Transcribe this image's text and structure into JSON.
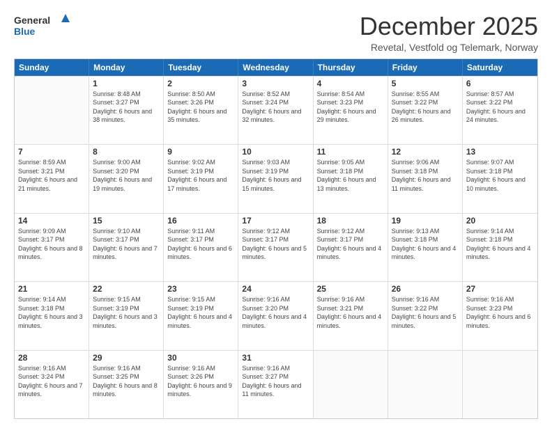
{
  "logo": {
    "line1": "General",
    "line2": "Blue"
  },
  "title": "December 2025",
  "location": "Revetal, Vestfold og Telemark, Norway",
  "days": [
    "Sunday",
    "Monday",
    "Tuesday",
    "Wednesday",
    "Thursday",
    "Friday",
    "Saturday"
  ],
  "weeks": [
    [
      {
        "day": "",
        "empty": true
      },
      {
        "day": "1",
        "sunrise": "8:48 AM",
        "sunset": "3:27 PM",
        "daylight": "6 hours and 38 minutes."
      },
      {
        "day": "2",
        "sunrise": "8:50 AM",
        "sunset": "3:26 PM",
        "daylight": "6 hours and 35 minutes."
      },
      {
        "day": "3",
        "sunrise": "8:52 AM",
        "sunset": "3:24 PM",
        "daylight": "6 hours and 32 minutes."
      },
      {
        "day": "4",
        "sunrise": "8:54 AM",
        "sunset": "3:23 PM",
        "daylight": "6 hours and 29 minutes."
      },
      {
        "day": "5",
        "sunrise": "8:55 AM",
        "sunset": "3:22 PM",
        "daylight": "6 hours and 26 minutes."
      },
      {
        "day": "6",
        "sunrise": "8:57 AM",
        "sunset": "3:22 PM",
        "daylight": "6 hours and 24 minutes."
      }
    ],
    [
      {
        "day": "7",
        "sunrise": "8:59 AM",
        "sunset": "3:21 PM",
        "daylight": "6 hours and 21 minutes."
      },
      {
        "day": "8",
        "sunrise": "9:00 AM",
        "sunset": "3:20 PM",
        "daylight": "6 hours and 19 minutes."
      },
      {
        "day": "9",
        "sunrise": "9:02 AM",
        "sunset": "3:19 PM",
        "daylight": "6 hours and 17 minutes."
      },
      {
        "day": "10",
        "sunrise": "9:03 AM",
        "sunset": "3:19 PM",
        "daylight": "6 hours and 15 minutes."
      },
      {
        "day": "11",
        "sunrise": "9:05 AM",
        "sunset": "3:18 PM",
        "daylight": "6 hours and 13 minutes."
      },
      {
        "day": "12",
        "sunrise": "9:06 AM",
        "sunset": "3:18 PM",
        "daylight": "6 hours and 11 minutes."
      },
      {
        "day": "13",
        "sunrise": "9:07 AM",
        "sunset": "3:18 PM",
        "daylight": "6 hours and 10 minutes."
      }
    ],
    [
      {
        "day": "14",
        "sunrise": "9:09 AM",
        "sunset": "3:17 PM",
        "daylight": "6 hours and 8 minutes."
      },
      {
        "day": "15",
        "sunrise": "9:10 AM",
        "sunset": "3:17 PM",
        "daylight": "6 hours and 7 minutes."
      },
      {
        "day": "16",
        "sunrise": "9:11 AM",
        "sunset": "3:17 PM",
        "daylight": "6 hours and 6 minutes."
      },
      {
        "day": "17",
        "sunrise": "9:12 AM",
        "sunset": "3:17 PM",
        "daylight": "6 hours and 5 minutes."
      },
      {
        "day": "18",
        "sunrise": "9:12 AM",
        "sunset": "3:17 PM",
        "daylight": "6 hours and 4 minutes."
      },
      {
        "day": "19",
        "sunrise": "9:13 AM",
        "sunset": "3:18 PM",
        "daylight": "6 hours and 4 minutes."
      },
      {
        "day": "20",
        "sunrise": "9:14 AM",
        "sunset": "3:18 PM",
        "daylight": "6 hours and 4 minutes."
      }
    ],
    [
      {
        "day": "21",
        "sunrise": "9:14 AM",
        "sunset": "3:18 PM",
        "daylight": "6 hours and 3 minutes."
      },
      {
        "day": "22",
        "sunrise": "9:15 AM",
        "sunset": "3:19 PM",
        "daylight": "6 hours and 3 minutes."
      },
      {
        "day": "23",
        "sunrise": "9:15 AM",
        "sunset": "3:19 PM",
        "daylight": "6 hours and 4 minutes."
      },
      {
        "day": "24",
        "sunrise": "9:16 AM",
        "sunset": "3:20 PM",
        "daylight": "6 hours and 4 minutes."
      },
      {
        "day": "25",
        "sunrise": "9:16 AM",
        "sunset": "3:21 PM",
        "daylight": "6 hours and 4 minutes."
      },
      {
        "day": "26",
        "sunrise": "9:16 AM",
        "sunset": "3:22 PM",
        "daylight": "6 hours and 5 minutes."
      },
      {
        "day": "27",
        "sunrise": "9:16 AM",
        "sunset": "3:23 PM",
        "daylight": "6 hours and 6 minutes."
      }
    ],
    [
      {
        "day": "28",
        "sunrise": "9:16 AM",
        "sunset": "3:24 PM",
        "daylight": "6 hours and 7 minutes."
      },
      {
        "day": "29",
        "sunrise": "9:16 AM",
        "sunset": "3:25 PM",
        "daylight": "6 hours and 8 minutes."
      },
      {
        "day": "30",
        "sunrise": "9:16 AM",
        "sunset": "3:26 PM",
        "daylight": "6 hours and 9 minutes."
      },
      {
        "day": "31",
        "sunrise": "9:16 AM",
        "sunset": "3:27 PM",
        "daylight": "6 hours and 11 minutes."
      },
      {
        "day": "",
        "empty": true
      },
      {
        "day": "",
        "empty": true
      },
      {
        "day": "",
        "empty": true
      }
    ]
  ]
}
